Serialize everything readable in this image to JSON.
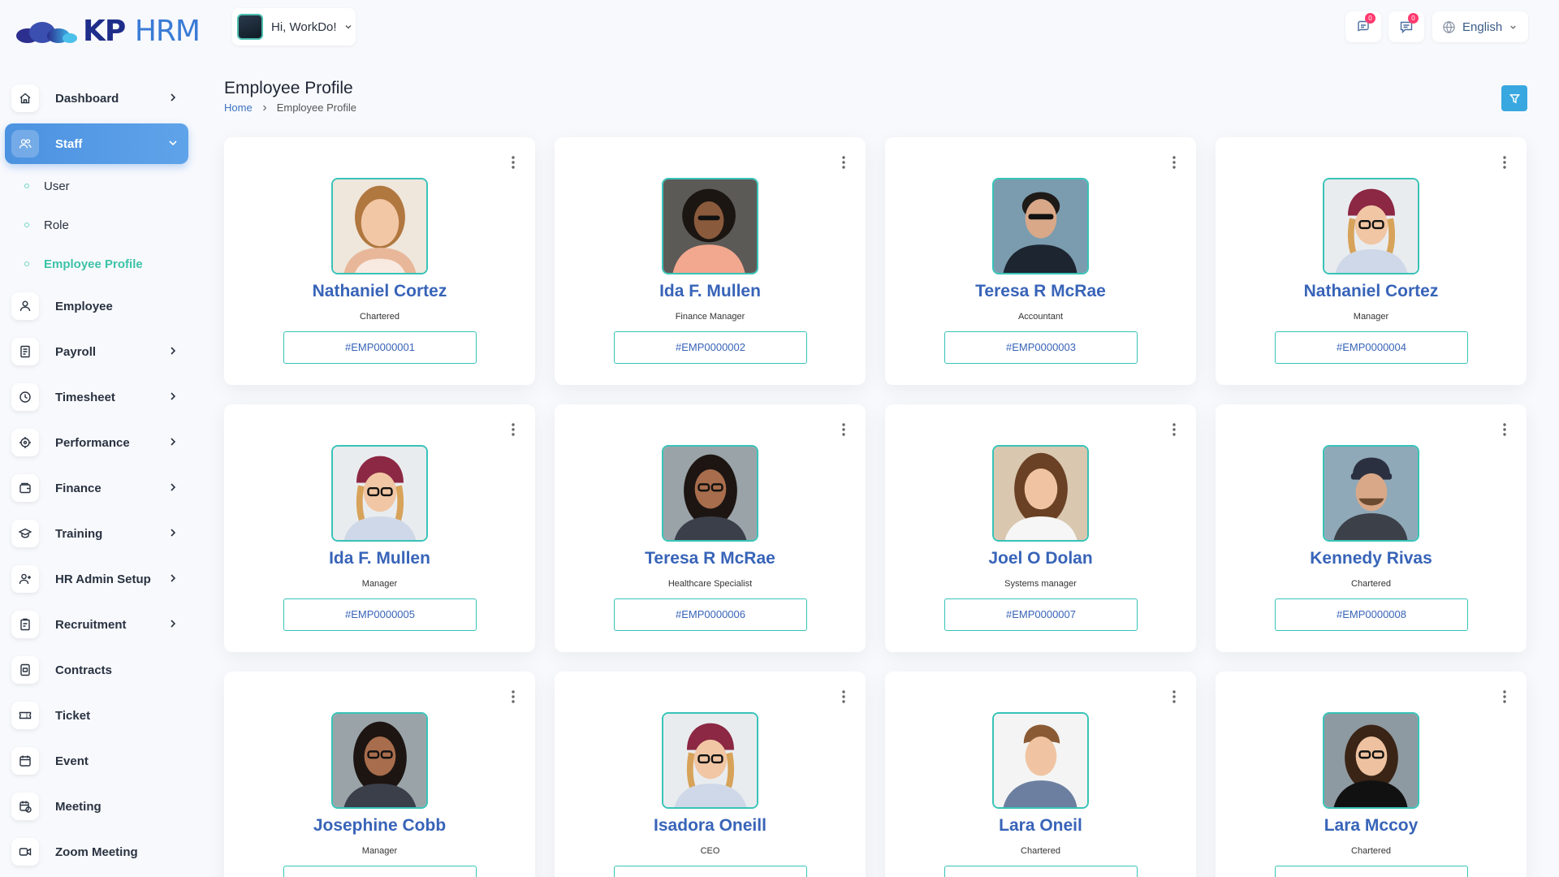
{
  "app": {
    "logo": "KP HRM",
    "logo_part1": "KP",
    "logo_part2": "HRM"
  },
  "topbar": {
    "greeting": "Hi, WorkDo!",
    "messages_count": "0",
    "notifications_count": "0",
    "language": "English"
  },
  "sidebar": {
    "items": [
      {
        "label": "Dashboard",
        "icon": "home-icon",
        "chevron": true
      },
      {
        "label": "Staff",
        "icon": "users-icon",
        "chevron": true,
        "active": true
      },
      {
        "label": "Employee",
        "icon": "user-icon",
        "chevron": false
      },
      {
        "label": "Payroll",
        "icon": "receipt-icon",
        "chevron": true
      },
      {
        "label": "Timesheet",
        "icon": "clock-icon",
        "chevron": true
      },
      {
        "label": "Performance",
        "icon": "target-icon",
        "chevron": true
      },
      {
        "label": "Finance",
        "icon": "wallet-icon",
        "chevron": true
      },
      {
        "label": "Training",
        "icon": "graduation-icon",
        "chevron": true
      },
      {
        "label": "HR Admin Setup",
        "icon": "user-plus-icon",
        "chevron": true
      },
      {
        "label": "Recruitment",
        "icon": "clipboard-icon",
        "chevron": true
      },
      {
        "label": "Contracts",
        "icon": "contract-icon",
        "chevron": false
      },
      {
        "label": "Ticket",
        "icon": "ticket-icon",
        "chevron": false
      },
      {
        "label": "Event",
        "icon": "calendar-icon",
        "chevron": false
      },
      {
        "label": "Meeting",
        "icon": "calendar-clock-icon",
        "chevron": false
      },
      {
        "label": "Zoom Meeting",
        "icon": "video-icon",
        "chevron": false
      }
    ],
    "staff_sub": [
      {
        "label": "User"
      },
      {
        "label": "Role"
      },
      {
        "label": "Employee Profile",
        "active": true
      }
    ]
  },
  "page": {
    "title": "Employee Profile",
    "breadcrumb_home": "Home",
    "breadcrumb_current": "Employee Profile"
  },
  "employees": [
    {
      "name": "Nathaniel Cortez",
      "role": "Chartered",
      "id": "#EMP0000001"
    },
    {
      "name": "Ida F. Mullen",
      "role": "Finance Manager",
      "id": "#EMP0000002"
    },
    {
      "name": "Teresa R McRae",
      "role": "Accountant",
      "id": "#EMP0000003"
    },
    {
      "name": "Nathaniel Cortez",
      "role": "Manager",
      "id": "#EMP0000004"
    },
    {
      "name": "Ida F. Mullen",
      "role": "Manager",
      "id": "#EMP0000005"
    },
    {
      "name": "Teresa R McRae",
      "role": "Healthcare Specialist",
      "id": "#EMP0000006"
    },
    {
      "name": "Joel O Dolan",
      "role": "Systems manager",
      "id": "#EMP0000007"
    },
    {
      "name": "Kennedy Rivas",
      "role": "Chartered",
      "id": "#EMP0000008"
    },
    {
      "name": "Josephine Cobb",
      "role": "Manager",
      "id": ""
    },
    {
      "name": "Isadora Oneill",
      "role": "CEO",
      "id": ""
    },
    {
      "name": "Lara Oneil",
      "role": "Chartered",
      "id": ""
    },
    {
      "name": "Lara Mccoy",
      "role": "Chartered",
      "id": ""
    }
  ],
  "colors": {
    "accent": "#4a90e2",
    "teal": "#38c3b8",
    "name_blue": "#3864b8",
    "badge": "#ff3a6e"
  }
}
